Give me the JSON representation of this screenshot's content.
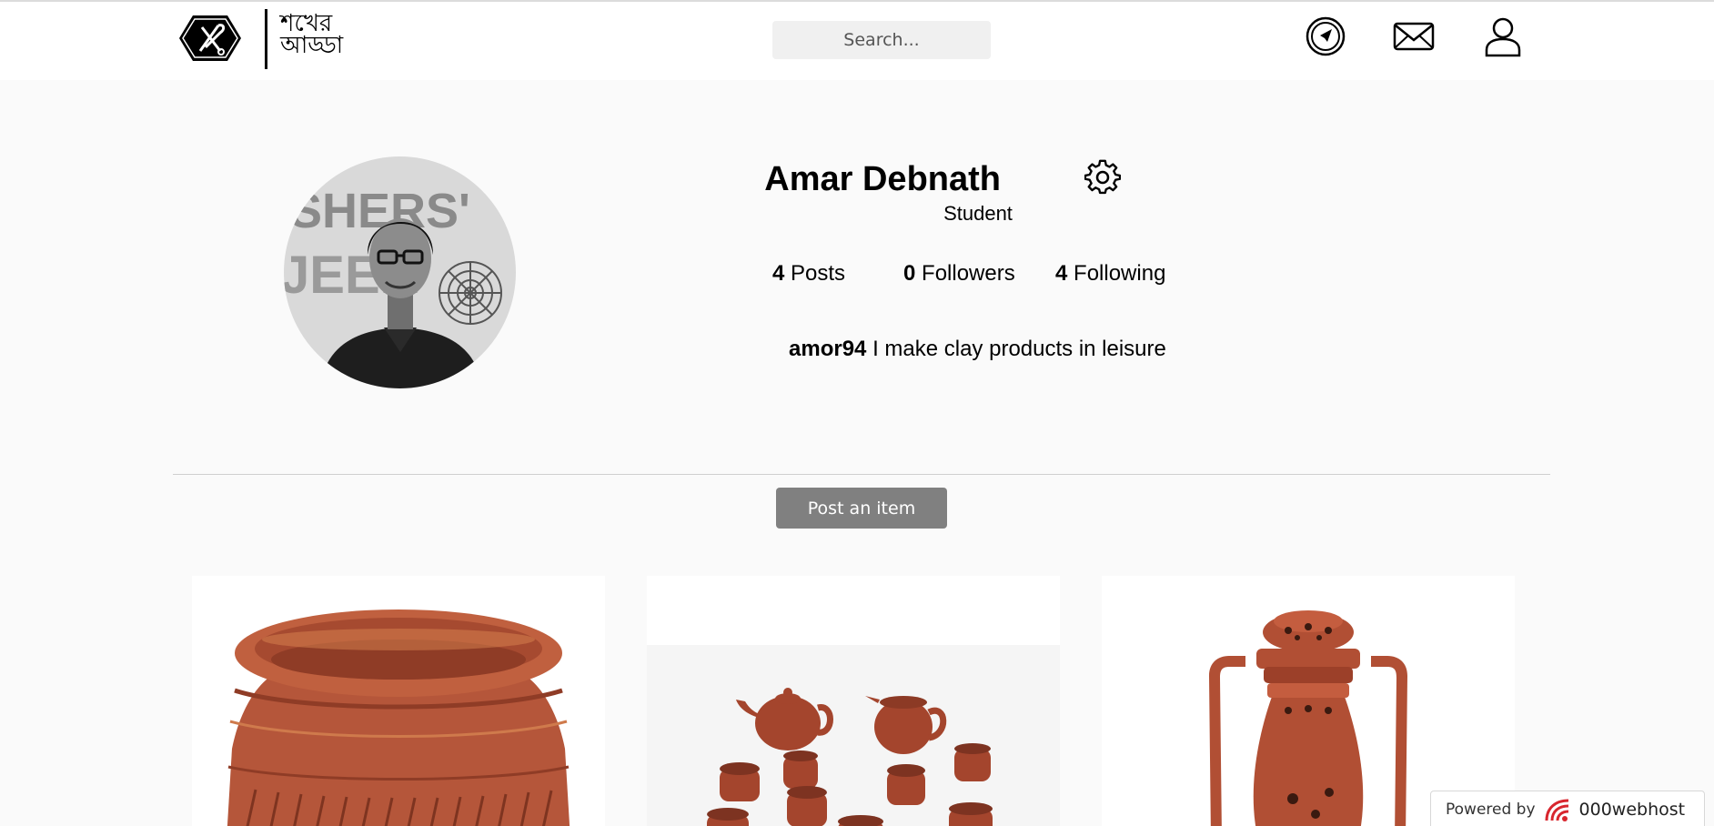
{
  "header": {
    "logo_text_line1": "শখের",
    "logo_text_line2": "আড্ডা",
    "search_placeholder": "Search..."
  },
  "icons": {
    "logo": "feather-hex-logo-icon",
    "explore": "compass-icon",
    "messages": "envelope-icon",
    "profile": "user-icon",
    "settings": "gear-icon"
  },
  "profile": {
    "name": "Amar Debnath",
    "role": "Student",
    "stats": {
      "posts_count": "4",
      "posts_label": "Posts",
      "followers_count": "0",
      "followers_label": "Followers",
      "following_count": "4",
      "following_label": "Following"
    },
    "username": "amor94",
    "bio": "I make clay products in leisure"
  },
  "actions": {
    "post_item": "Post an item"
  },
  "footer": {
    "powered_by": "Powered by",
    "host_brand": "000webhost"
  },
  "colors": {
    "terracotta": "#b5563a",
    "button_gray": "#808080",
    "page_bg": "#fafafa"
  }
}
